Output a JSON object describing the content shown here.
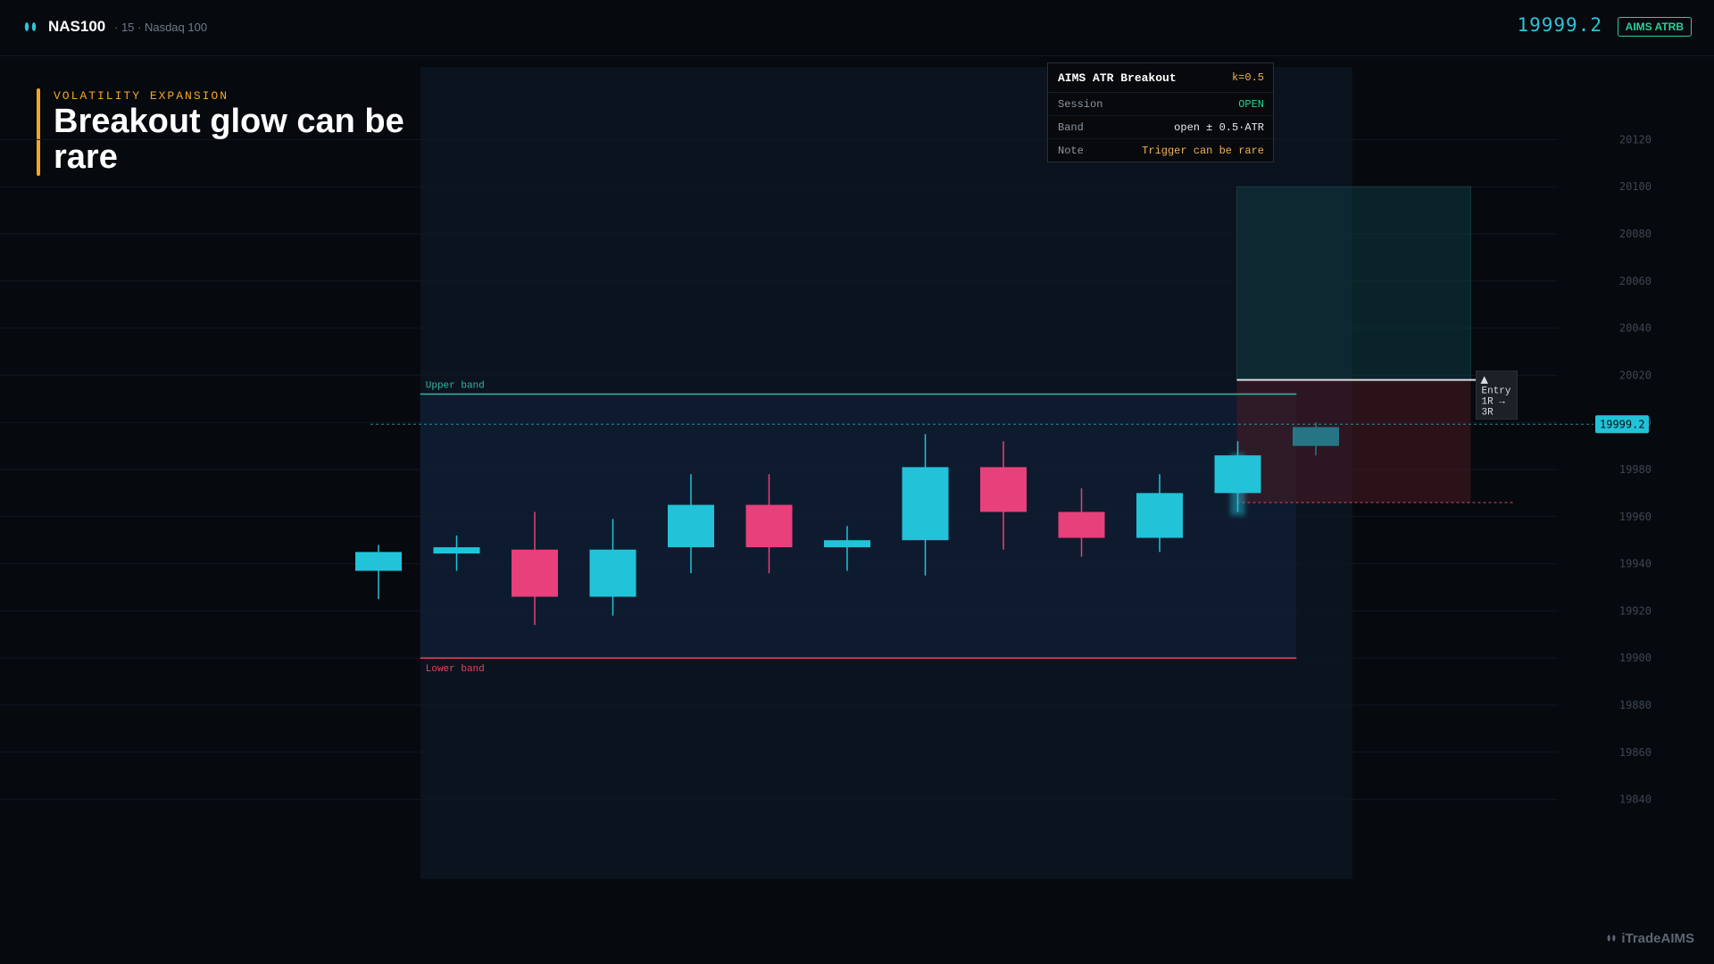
{
  "header": {
    "symbol": "NAS100",
    "meta": "· 15 · Nasdaq 100",
    "last_price": "19999.2",
    "indicator_badge": "AIMS ATRB"
  },
  "headline": {
    "kicker": "VOLATILITY EXPANSION",
    "title": "Breakout glow can be rare"
  },
  "panel": {
    "title": "AIMS ATR Breakout",
    "param": "k=0.5",
    "rows": [
      {
        "label": "Session",
        "value": "OPEN"
      },
      {
        "label": "Band",
        "value": "open ± 0.5·ATR"
      },
      {
        "label": "Note",
        "value": "Trigger can be rare"
      }
    ]
  },
  "colors": {
    "bull": "#22c3d8",
    "bear": "#e8407a",
    "upper_band": "#2fb9a6",
    "lower_band": "#e0485e",
    "accent": "#f5a623"
  },
  "watermark": "iTradeAIMS",
  "chart_data": {
    "type": "candlestick",
    "y_ticks": [
      20120,
      20100,
      20080,
      20060,
      20040,
      20020,
      20000,
      19980,
      19960,
      19940,
      19920,
      19900,
      19880,
      19860,
      19840
    ],
    "ylim": [
      19830,
      20130
    ],
    "candles": [
      {
        "o": 19937,
        "h": 19948,
        "l": 19925,
        "c": 19945
      },
      {
        "o": 19946,
        "h": 19952,
        "l": 19937,
        "c": 19947
      },
      {
        "o": 19946,
        "h": 19962,
        "l": 19914,
        "c": 19926
      },
      {
        "o": 19926,
        "h": 19959,
        "l": 19918,
        "c": 19946
      },
      {
        "o": 19947,
        "h": 19978,
        "l": 19936,
        "c": 19965
      },
      {
        "o": 19965,
        "h": 19978,
        "l": 19936,
        "c": 19947
      },
      {
        "o": 19947,
        "h": 19956,
        "l": 19937,
        "c": 19950
      },
      {
        "o": 19950,
        "h": 19995,
        "l": 19935,
        "c": 19981
      },
      {
        "o": 19981,
        "h": 19992,
        "l": 19946,
        "c": 19962
      },
      {
        "o": 19962,
        "h": 19972,
        "l": 19943,
        "c": 19951
      },
      {
        "o": 19951,
        "h": 19978,
        "l": 19945,
        "c": 19970
      },
      {
        "o": 19970,
        "h": 19992,
        "l": 19962,
        "c": 19986
      },
      {
        "o": 19990,
        "h": 20000,
        "l": 19986,
        "c": 19998
      }
    ],
    "session_start_index": 1,
    "upper_band": 20012,
    "lower_band": 19900,
    "upper_band_label": "Upper band",
    "lower_band_label": "Lower band",
    "last_price": 19999.2,
    "last_price_label": "19999.2",
    "entry": 20018,
    "stop": 19966,
    "target": 20100,
    "entry_labels": [
      "Entry",
      "1R →",
      "3R"
    ]
  }
}
